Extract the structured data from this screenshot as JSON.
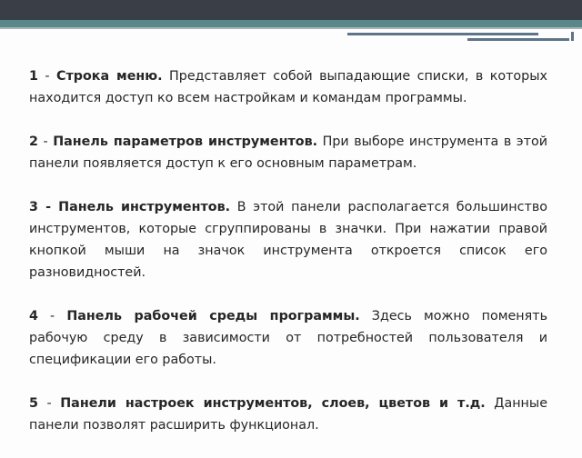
{
  "items": [
    {
      "num": "1",
      "sep": " - ",
      "title": "Строка меню.",
      "text": " Представляет собой выпадающие списки, в которых находится доступ ко всем настройкам и командам программы."
    },
    {
      "num": "2",
      "sep": " - ",
      "title": "Панель параметров инструментов.",
      "text": " При выборе инструмента в этой панели появляется доступ к его основным параметрам."
    },
    {
      "num": "3",
      "sep": " - ",
      "title": "Панель инструментов.",
      "text": " В этой панели располагается большинство инструментов, которые сгруппированы в значки. При нажатии правой кнопкой мыши на значок инструмента откроется список его разновидностей."
    },
    {
      "num": "4",
      "sep": " - ",
      "title": "Панель рабочей среды программы.",
      "text": " Здесь можно поменять рабочую среду в зависимости от потребностей пользователя и спецификации его работы."
    },
    {
      "num": "5",
      "sep": " - ",
      "title": "Панели настроек инструментов, слоев, цветов и т.д.",
      "text": " Данные панели позволят расширить функционал."
    }
  ]
}
